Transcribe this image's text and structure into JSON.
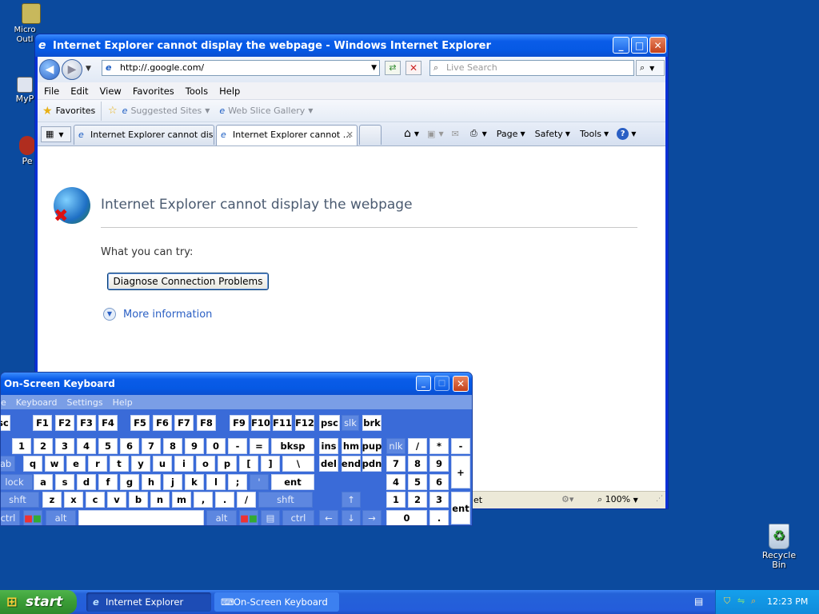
{
  "desktop": {
    "icons": [
      {
        "name": "Micro Outl"
      },
      {
        "name": "MyP"
      },
      {
        "name": "Pe"
      }
    ],
    "recycle_bin": "Recycle Bin"
  },
  "ie": {
    "title": "Internet Explorer cannot display the webpage - Windows Internet Explorer",
    "address": "http://.google.com/",
    "search_placeholder": "Live Search",
    "menu": [
      "File",
      "Edit",
      "View",
      "Favorites",
      "Tools",
      "Help"
    ],
    "favorites_label": "Favorites",
    "suggested_sites": "Suggested Sites",
    "web_slice_gallery": "Web Slice Gallery",
    "tabs": [
      {
        "label": "Internet Explorer cannot dis..."
      },
      {
        "label": "Internet Explorer cannot ..."
      }
    ],
    "cmd": {
      "page": "Page",
      "safety": "Safety",
      "tools": "Tools"
    },
    "content": {
      "heading": "Internet Explorer cannot display the webpage",
      "try_label": "What you can try:",
      "diagnose_button": "Diagnose Connection Problems",
      "more_info": "More information"
    },
    "status": {
      "text": "et",
      "zoom": "100%"
    }
  },
  "osk": {
    "title": "On-Screen Keyboard",
    "menu": [
      "e",
      "Keyboard",
      "Settings",
      "Help"
    ],
    "row1": [
      "sc",
      "F1",
      "F2",
      "F3",
      "F4",
      "F5",
      "F6",
      "F7",
      "F8",
      "F9",
      "F10",
      "F11",
      "F12",
      "psc",
      "slk",
      "brk"
    ],
    "row2": [
      "1",
      "2",
      "3",
      "4",
      "5",
      "6",
      "7",
      "8",
      "9",
      "0",
      "-",
      "=",
      "bksp",
      "ins",
      "hm",
      "pup",
      "nlk",
      "/",
      "*",
      "-"
    ],
    "row3": [
      "ab",
      "q",
      "w",
      "e",
      "r",
      "t",
      "y",
      "u",
      "i",
      "o",
      "p",
      "[",
      "]",
      "\\",
      "del",
      "end",
      "pdn",
      "7",
      "8",
      "9",
      "+"
    ],
    "row4": [
      "lock",
      "a",
      "s",
      "d",
      "f",
      "g",
      "h",
      "j",
      "k",
      "l",
      ";",
      "'",
      "ent",
      "4",
      "5",
      "6"
    ],
    "row5": [
      "shft",
      "z",
      "x",
      "c",
      "v",
      "b",
      "n",
      "m",
      ",",
      ".",
      "/",
      "shft",
      "1",
      "2",
      "3",
      "ent"
    ],
    "row6": [
      "ctrl",
      "alt",
      "alt",
      "ctrl",
      "0",
      "."
    ],
    "arrows": {
      "up": "↑",
      "left": "←",
      "down": "↓",
      "right": "→"
    }
  },
  "taskbar": {
    "start": "start",
    "items": [
      {
        "label": "Internet Explorer can..."
      },
      {
        "label": "On-Screen Keyboard"
      }
    ],
    "clock": "12:23 PM"
  }
}
